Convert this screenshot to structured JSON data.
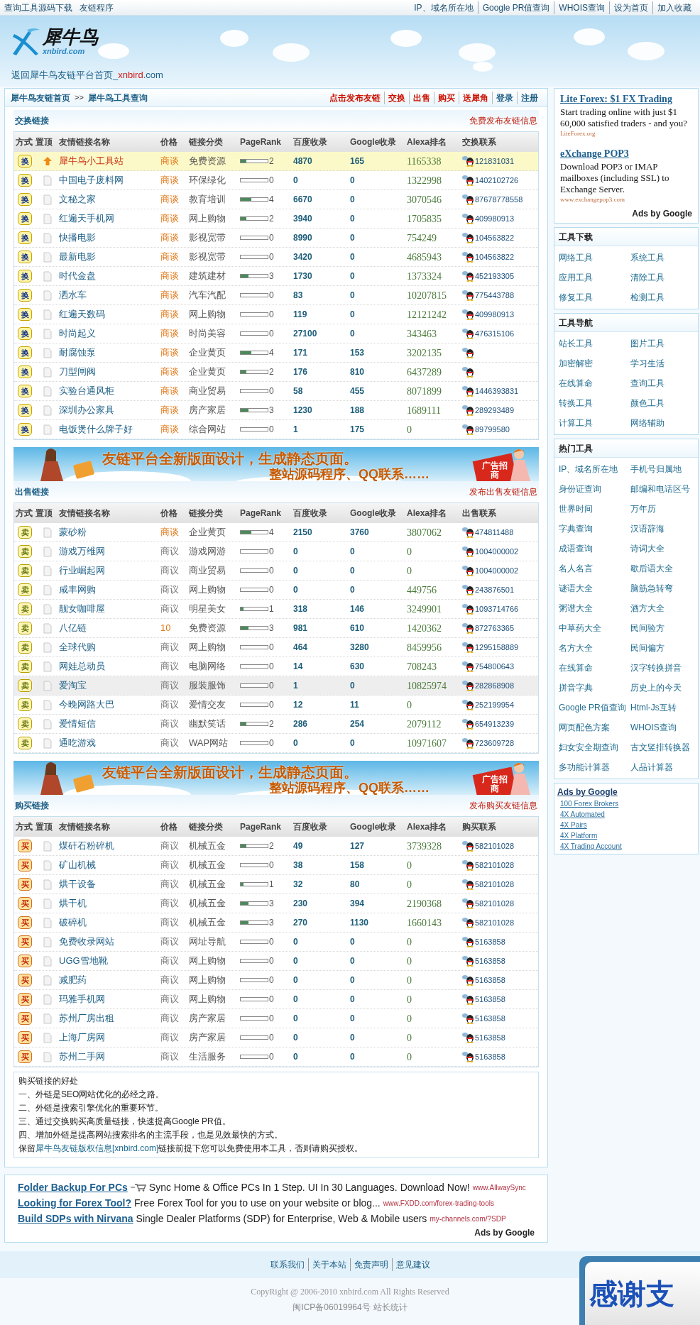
{
  "top_bar": {
    "left_links": [
      "查询工具源码下载",
      "友链程序"
    ],
    "right_links": [
      "IP、域名所在地",
      "Google PR值查询",
      "WHOIS查询",
      "设为首页",
      "加入收藏"
    ]
  },
  "header": {
    "logo_name": "犀牛鸟",
    "logo_domain": "xnbird.com",
    "home_link": {
      "prefix": "返回犀牛鸟友链平台首页_",
      "highlight": "xnbird",
      "suffix": ".com"
    }
  },
  "breadcrumb": {
    "home": "犀牛鸟友链首页",
    "separator": ">>",
    "current": "犀牛鸟工具查询"
  },
  "nav_links": [
    {
      "label": "点击发布友链",
      "color": "#cc1100"
    },
    {
      "label": "交换",
      "color": "#cc1100"
    },
    {
      "label": "出售",
      "color": "#cc1100"
    },
    {
      "label": "购买",
      "color": "#cc1100"
    },
    {
      "label": "送犀角",
      "color": "#cc1100"
    },
    {
      "label": "登录",
      "color": "#1d5f86"
    },
    {
      "label": "注册",
      "color": "#1d5f86"
    }
  ],
  "sections": [
    {
      "kind": "exchange",
      "title": "交换链接",
      "action": "免费发布友链信息",
      "columns": [
        "方式",
        "置顶",
        "友情链接名称",
        "价格",
        "链接分类",
        "PageRank",
        "百度收录",
        "Google收录",
        "Alexa排名",
        "交换联系"
      ],
      "rows": [
        {
          "mode": "换",
          "pinned": true,
          "hovered": false,
          "name": "犀牛鸟小工具站",
          "price": "商谈",
          "price_hot": true,
          "category": "免费资源",
          "level": 0.2,
          "pr": "2",
          "baidu": "4870",
          "google": "165",
          "alexa": "1165338",
          "qq": "121831031"
        },
        {
          "mode": "换",
          "pinned": false,
          "hovered": false,
          "name": "中国电子废料网",
          "price": "商谈",
          "price_hot": true,
          "category": "环保绿化",
          "level": 0,
          "pr": "0",
          "baidu": "0",
          "google": "0",
          "alexa": "1322998",
          "qq": "1402102726"
        },
        {
          "mode": "换",
          "pinned": false,
          "hovered": false,
          "name": "文秘之家",
          "price": "商谈",
          "price_hot": true,
          "category": "教育培训",
          "level": 0.4,
          "pr": "4",
          "baidu": "6670",
          "google": "0",
          "alexa": "3070546",
          "qq": "87678778558"
        },
        {
          "mode": "换",
          "pinned": false,
          "hovered": false,
          "name": "红遍天手机网",
          "price": "商谈",
          "price_hot": true,
          "category": "网上购物",
          "level": 0.2,
          "pr": "2",
          "baidu": "3940",
          "google": "0",
          "alexa": "1705835",
          "qq": "409980913"
        },
        {
          "mode": "换",
          "pinned": false,
          "hovered": false,
          "name": "快播电影",
          "price": "商谈",
          "price_hot": true,
          "category": "影视宽带",
          "level": 0,
          "pr": "0",
          "baidu": "8990",
          "google": "0",
          "alexa": "754249",
          "qq": "104563822"
        },
        {
          "mode": "换",
          "pinned": false,
          "hovered": false,
          "name": "最新电影",
          "price": "商谈",
          "price_hot": true,
          "category": "影视宽带",
          "level": 0,
          "pr": "0",
          "baidu": "3420",
          "google": "0",
          "alexa": "4685943",
          "qq": "104563822"
        },
        {
          "mode": "换",
          "pinned": false,
          "hovered": false,
          "name": "时代金盘",
          "price": "商谈",
          "price_hot": true,
          "category": "建筑建材",
          "level": 0.3,
          "pr": "3",
          "baidu": "1730",
          "google": "0",
          "alexa": "1373324",
          "qq": "452193305"
        },
        {
          "mode": "换",
          "pinned": false,
          "hovered": false,
          "name": "洒水车",
          "price": "商谈",
          "price_hot": true,
          "category": "汽车汽配",
          "level": 0,
          "pr": "0",
          "baidu": "83",
          "google": "0",
          "alexa": "10207815",
          "qq": "775443788"
        },
        {
          "mode": "换",
          "pinned": false,
          "hovered": false,
          "name": "红遍天数码",
          "price": "商谈",
          "price_hot": true,
          "category": "网上购物",
          "level": 0,
          "pr": "0",
          "baidu": "119",
          "google": "0",
          "alexa": "12121242",
          "qq": "409980913"
        },
        {
          "mode": "换",
          "pinned": false,
          "hovered": false,
          "name": "时尚起义",
          "price": "商谈",
          "price_hot": true,
          "category": "时尚美容",
          "level": 0,
          "pr": "0",
          "baidu": "27100",
          "google": "0",
          "alexa": "343463",
          "qq": "476315106"
        },
        {
          "mode": "换",
          "pinned": false,
          "hovered": false,
          "name": "耐腐蚀泵",
          "price": "商谈",
          "price_hot": true,
          "category": "企业黄页",
          "level": 0.4,
          "pr": "4",
          "baidu": "171",
          "google": "153",
          "alexa": "3202135"
        },
        {
          "mode": "换",
          "pinned": false,
          "hovered": false,
          "name": "刀型闸阀",
          "price": "商谈",
          "price_hot": true,
          "category": "企业黄页",
          "level": 0.2,
          "pr": "2",
          "baidu": "176",
          "google": "810",
          "alexa": "6437289"
        },
        {
          "mode": "换",
          "pinned": false,
          "hovered": false,
          "name": "实验台通风柜",
          "price": "商谈",
          "price_hot": true,
          "category": "商业贸易",
          "level": 0,
          "pr": "0",
          "baidu": "58",
          "google": "455",
          "alexa": "8071899",
          "qq": "1446393831"
        },
        {
          "mode": "换",
          "pinned": false,
          "hovered": false,
          "name": "深圳办公家具",
          "price": "商谈",
          "price_hot": true,
          "category": "房产家居",
          "level": 0.3,
          "pr": "3",
          "baidu": "1230",
          "google": "188",
          "alexa": "1689111",
          "qq": "289293489"
        },
        {
          "mode": "换",
          "pinned": false,
          "hovered": false,
          "name": "电饭煲什么牌子好",
          "price": "商谈",
          "price_hot": true,
          "category": "综合网站",
          "level": 0,
          "pr": "0",
          "baidu": "1",
          "google": "175",
          "alexa": "0",
          "qq": "89799580"
        }
      ]
    },
    {
      "kind": "sell",
      "banner": {
        "headline": "友链平台全新版面设计，生成静态页面。",
        "subline": "整站源码程序、QQ联系……",
        "badge": "广告招商"
      },
      "title": "出售链接",
      "action": "发布出售友链信息",
      "columns": [
        "方式",
        "置顶",
        "友情链接名称",
        "价格",
        "链接分类",
        "PageRank",
        "百度收录",
        "Google收录",
        "Alexa排名",
        "出售联系"
      ],
      "rows": [
        {
          "mode": "卖",
          "pinned": false,
          "hovered": false,
          "name": "蒙砂粉",
          "price": "商谈",
          "price_hot": true,
          "category": "企业黄页",
          "level": 0.4,
          "pr": "4",
          "baidu": "2150",
          "google": "3760",
          "alexa": "3807062",
          "qq": "474811488"
        },
        {
          "mode": "卖",
          "pinned": false,
          "hovered": false,
          "name": "游戏万维网",
          "price": "商议",
          "price_hot": false,
          "category": "游戏网游",
          "level": 0,
          "pr": "0",
          "baidu": "0",
          "google": "0",
          "alexa": "0",
          "qq": "1004000002"
        },
        {
          "mode": "卖",
          "pinned": false,
          "hovered": false,
          "name": "行业崛起网",
          "price": "商议",
          "price_hot": false,
          "category": "商业贸易",
          "level": 0,
          "pr": "0",
          "baidu": "0",
          "google": "0",
          "alexa": "0",
          "qq": "1004000002"
        },
        {
          "mode": "卖",
          "pinned": false,
          "hovered": false,
          "name": "咸丰网购",
          "price": "商议",
          "price_hot": false,
          "category": "网上购物",
          "level": 0,
          "pr": "0",
          "baidu": "0",
          "google": "0",
          "alexa": "449756",
          "qq": "243876501"
        },
        {
          "mode": "卖",
          "pinned": false,
          "hovered": false,
          "name": "靓女咖啡屋",
          "price": "商议",
          "price_hot": false,
          "category": "明星美女",
          "level": 0.1,
          "pr": "1",
          "baidu": "318",
          "google": "146",
          "alexa": "3249901",
          "qq": "1093714766"
        },
        {
          "mode": "卖",
          "pinned": false,
          "hovered": false,
          "name": "八亿链",
          "price": "10",
          "price_hot": true,
          "category": "免费资源",
          "level": 0.3,
          "pr": "3",
          "baidu": "981",
          "google": "610",
          "alexa": "1420362",
          "qq": "872763365"
        },
        {
          "mode": "卖",
          "pinned": false,
          "hovered": false,
          "name": "全球代购",
          "price": "商议",
          "price_hot": false,
          "category": "网上购物",
          "level": 0,
          "pr": "0",
          "baidu": "464",
          "google": "3280",
          "alexa": "8459956",
          "qq": "1295158889"
        },
        {
          "mode": "卖",
          "pinned": false,
          "hovered": false,
          "name": "网娃总动员",
          "price": "商议",
          "price_hot": false,
          "category": "电脑网络",
          "level": 0,
          "pr": "0",
          "baidu": "14",
          "google": "630",
          "alexa": "708243",
          "qq": "754800643"
        },
        {
          "mode": "卖",
          "pinned": false,
          "hovered": true,
          "name": "爱淘宝",
          "price": "商议",
          "price_hot": false,
          "category": "服装服饰",
          "level": 0,
          "pr": "0",
          "baidu": "1",
          "google": "0",
          "alexa": "10825974",
          "qq": "282868908"
        },
        {
          "mode": "卖",
          "pinned": false,
          "hovered": false,
          "name": "今晚网路大巴",
          "price": "商议",
          "price_hot": false,
          "category": "爱情交友",
          "level": 0,
          "pr": "0",
          "baidu": "12",
          "google": "11",
          "alexa": "0",
          "qq": "252199954"
        },
        {
          "mode": "卖",
          "pinned": false,
          "hovered": false,
          "name": "爱情短信",
          "price": "商议",
          "price_hot": false,
          "category": "幽默笑话",
          "level": 0.2,
          "pr": "2",
          "baidu": "286",
          "google": "254",
          "alexa": "2079112",
          "qq": "654913239"
        },
        {
          "mode": "卖",
          "pinned": false,
          "hovered": false,
          "name": "通吃游戏",
          "price": "商议",
          "price_hot": false,
          "category": "WAP网站",
          "level": 0,
          "pr": "0",
          "baidu": "0",
          "google": "0",
          "alexa": "10971607",
          "qq": "723609728"
        }
      ]
    },
    {
      "kind": "buy",
      "banner": {
        "headline": "友链平台全新版面设计，生成静态页面。",
        "subline": "整站源码程序、QQ联系……",
        "badge": "广告招商"
      },
      "title": "购买链接",
      "action": "发布购买友链信息",
      "columns": [
        "方式",
        "置顶",
        "友情链接名称",
        "价格",
        "链接分类",
        "PageRank",
        "百度收录",
        "Google收录",
        "Alexa排名",
        "购买联系"
      ],
      "rows": [
        {
          "mode": "买",
          "pinned": false,
          "hovered": false,
          "name": "煤矸石粉碎机",
          "price": "商议",
          "price_hot": false,
          "category": "机械五金",
          "level": 0.2,
          "pr": "2",
          "baidu": "49",
          "google": "127",
          "alexa": "3739328",
          "qq": "582101028"
        },
        {
          "mode": "买",
          "pinned": false,
          "hovered": false,
          "name": "矿山机械",
          "price": "商议",
          "price_hot": false,
          "category": "机械五金",
          "level": 0,
          "pr": "0",
          "baidu": "38",
          "google": "158",
          "alexa": "0",
          "qq": "582101028"
        },
        {
          "mode": "买",
          "pinned": false,
          "hovered": false,
          "name": "烘干设备",
          "price": "商议",
          "price_hot": false,
          "category": "机械五金",
          "level": 0.1,
          "pr": "1",
          "baidu": "32",
          "google": "80",
          "alexa": "0",
          "qq": "582101028"
        },
        {
          "mode": "买",
          "pinned": false,
          "hovered": false,
          "name": "烘干机",
          "price": "商议",
          "price_hot": false,
          "category": "机械五金",
          "level": 0.3,
          "pr": "3",
          "baidu": "230",
          "google": "394",
          "alexa": "2190368",
          "qq": "582101028"
        },
        {
          "mode": "买",
          "pinned": false,
          "hovered": false,
          "name": "破碎机",
          "price": "商议",
          "price_hot": false,
          "category": "机械五金",
          "level": 0.3,
          "pr": "3",
          "baidu": "270",
          "google": "1130",
          "alexa": "1660143",
          "qq": "582101028"
        },
        {
          "mode": "买",
          "pinned": false,
          "hovered": false,
          "name": "免费收录网站",
          "price": "商议",
          "price_hot": false,
          "category": "网址导航",
          "level": 0,
          "pr": "0",
          "baidu": "0",
          "google": "0",
          "alexa": "0",
          "qq": "5163858"
        },
        {
          "mode": "买",
          "pinned": false,
          "hovered": false,
          "name": "UGG雪地靴",
          "price": "商议",
          "price_hot": false,
          "category": "网上购物",
          "level": 0,
          "pr": "0",
          "baidu": "0",
          "google": "0",
          "alexa": "0",
          "qq": "5163858"
        },
        {
          "mode": "买",
          "pinned": false,
          "hovered": false,
          "name": "减肥药",
          "price": "商议",
          "price_hot": false,
          "category": "网上购物",
          "level": 0,
          "pr": "0",
          "baidu": "0",
          "google": "0",
          "alexa": "0",
          "qq": "5163858"
        },
        {
          "mode": "买",
          "pinned": false,
          "hovered": false,
          "name": "玛雅手机网",
          "price": "商议",
          "price_hot": false,
          "category": "网上购物",
          "level": 0,
          "pr": "0",
          "baidu": "0",
          "google": "0",
          "alexa": "0",
          "qq": "5163858"
        },
        {
          "mode": "买",
          "pinned": false,
          "hovered": false,
          "name": "苏州厂房出租",
          "price": "商议",
          "price_hot": false,
          "category": "房产家居",
          "level": 0,
          "pr": "0",
          "baidu": "0",
          "google": "0",
          "alexa": "0",
          "qq": "5163858"
        },
        {
          "mode": "买",
          "pinned": false,
          "hovered": false,
          "name": "上海厂房网",
          "price": "商议",
          "price_hot": false,
          "category": "房产家居",
          "level": 0,
          "pr": "0",
          "baidu": "0",
          "google": "0",
          "alexa": "0",
          "qq": "5163858"
        },
        {
          "mode": "买",
          "pinned": false,
          "hovered": false,
          "name": "苏州二手网",
          "price": "商议",
          "price_hot": false,
          "category": "生活服务",
          "level": 0,
          "pr": "0",
          "baidu": "0",
          "google": "0",
          "alexa": "0",
          "qq": "5163858"
        }
      ]
    }
  ],
  "note": {
    "title": "购买链接的好处",
    "lines": [
      "一、外链是SEO网站优化的必经之路。",
      "二、外链是搜索引擎优化的重要环节。",
      "三、通过交换购买高质量链接，快速提高Google PR值。",
      "四、增加外链是提高网站搜索排名的主流手段，也是见效最快的方式。"
    ],
    "license": {
      "prefix": "保留",
      "link": "犀牛鸟友链版权信息[xnbird.com]",
      "suffix": "链接前提下您可以免费使用本工具，否则请购买授权。"
    }
  },
  "bottom_ads": {
    "items": [
      {
        "title": "Folder Backup For PCs",
        "has_icon": true,
        "body": "Sync Home & Office PCs In 1 Step. UI In 30 Languages. Download Now!",
        "url": "www.AllwaySync"
      },
      {
        "title": "Looking for Forex Tool?",
        "has_icon": false,
        "body": "Free Forex Tool for you to use on your website or blog...",
        "url": "www.FXDD.com/forex-trading-tools"
      },
      {
        "title": "Build SDPs with Nirvana",
        "has_icon": false,
        "body": "Single Dealer Platforms (SDP) for Enterprise, Web & Mobile users",
        "url": "my-channels.com/?SDP"
      }
    ],
    "label": "Ads by Google"
  },
  "sidebar": {
    "ads": {
      "items": [
        {
          "title": "Lite Forex: $1 FX Trading",
          "body": "Start trading online with just $1 60,000 satisfied traders - and you?",
          "url": "LiteForex.org"
        },
        {
          "title": "eXchange POP3",
          "body": "Download POP3 or IMAP mailboxes (including SSL) to Exchange Server.",
          "url": "www.exchangepop3.com"
        }
      ],
      "label": "Ads by Google"
    },
    "tool_groups": [
      {
        "title": "工具下载",
        "items": [
          "网络工具",
          "系统工具",
          "应用工具",
          "清除工具",
          "修复工具",
          "检测工具"
        ]
      },
      {
        "title": "工具导航",
        "items": [
          "站长工具",
          "图片工具",
          "加密解密",
          "学习生活",
          "在线算命",
          "查询工具",
          "转换工具",
          "颜色工具",
          "计算工具",
          "网络辅助"
        ]
      },
      {
        "title": "热门工具",
        "items": [
          "IP、域名所在地",
          "手机号归属地",
          "身份证查询",
          "邮编和电话区号",
          "世界时间",
          "万年历",
          "字典查询",
          "汉语辞海",
          "成语查询",
          "诗词大全",
          "名人名言",
          "歇后语大全",
          "谜语大全",
          "脑筋急转弯",
          "粥谱大全",
          "酒方大全",
          "中草药大全",
          "民间验方",
          "名方大全",
          "民间偏方",
          "在线算命",
          "汉字转换拼音",
          "拼音字典",
          "历史上的今天",
          "Google PR值查询",
          "Html-Js互转",
          "网页配色方案",
          "WHOIS查询",
          "妇女安全期查询",
          "古文竖排转换器",
          "多功能计算器",
          "人品计算器"
        ]
      }
    ],
    "link_ads": {
      "title": "Ads by Google",
      "links": [
        "100 Forex Brokers",
        "4X Automated",
        "4X Pairs",
        "4X Platform",
        "4X Trading Account"
      ]
    }
  },
  "footer": {
    "links": [
      "联系我们",
      "关于本站",
      "免责声明",
      "意见建议"
    ],
    "copyright": "CopyRight @ 2006-2010 xnbird.com All Rights Reserved",
    "icp": "闽ICP备06019964号",
    "stats": "站长统计"
  },
  "support_panel": {
    "text": "感谢支"
  }
}
